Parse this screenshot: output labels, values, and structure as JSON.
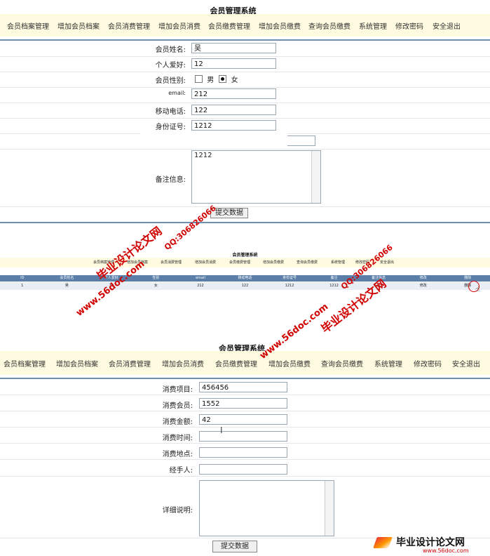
{
  "panel1": {
    "title": "会员管理系统",
    "nav": [
      "会员档案管理",
      "增加会员档案",
      "会员消费管理",
      "增加会员消费",
      "会员缴费管理",
      "增加会员缴费",
      "查询会员缴费",
      "系统管理",
      "修改密码",
      "安全退出"
    ],
    "fields": [
      {
        "label": "会员姓名:",
        "value": "吴"
      },
      {
        "label": "个人爱好:",
        "value": "12"
      },
      {
        "label": "email:",
        "value": "212"
      },
      {
        "label": "移动电话:",
        "value": "122"
      },
      {
        "label": "身份证号:",
        "value": "1212"
      }
    ],
    "gender": {
      "label": "会员性别:",
      "male": "男",
      "female": "女"
    },
    "remark": {
      "label": "备注信息:",
      "value": "1212"
    },
    "submit": "提交数据"
  },
  "panel2": {
    "title": "会员管理系统",
    "nav": [
      "会员档案管理",
      "增加会员档案",
      "会员消费管理",
      "增加会员消费",
      "会员缴费管理",
      "增加会员缴费",
      "查询会员缴费",
      "系统管理",
      "修改密码",
      "安全退出"
    ],
    "headers": [
      "ID",
      "会员姓名",
      "个人爱好",
      "性别",
      "email",
      "移动电话",
      "身份证号",
      "备注",
      "备注信息",
      "修改",
      "删除"
    ],
    "row": [
      "1",
      "吴",
      "12",
      "女",
      "212",
      "122",
      "1212",
      "1212",
      "1212",
      "修改",
      "删除"
    ]
  },
  "panel3": {
    "title": "会员管理系统",
    "nav": [
      "会员档案管理",
      "增加会员档案",
      "会员消费管理",
      "增加会员消费",
      "会员缴费管理",
      "增加会员缴费",
      "查询会员缴费",
      "系统管理",
      "修改密码",
      "安全退出"
    ],
    "fields": [
      {
        "label": "消费项目:",
        "value": "456456"
      },
      {
        "label": "消费会员:",
        "value": "1552"
      },
      {
        "label": "消费金额:",
        "value": "42"
      },
      {
        "label": "消费时间:",
        "value": ""
      },
      {
        "label": "消费地点:",
        "value": ""
      },
      {
        "label": "经手人:",
        "value": ""
      }
    ],
    "detail": {
      "label": "详细说明:",
      "value": ""
    },
    "submit": "提交数据"
  },
  "watermark": {
    "site": "毕业设计论文网",
    "url": "www.56doc.com",
    "qq": "QQ:306826066",
    "footer_site": "毕业设计论文网",
    "footer_url": "www.56doc.com"
  },
  "colors": {
    "nav_bg": "#fffbe0",
    "table_header": "#5a7ea8",
    "watermark": "#d10000",
    "line": "#6f8fb0"
  }
}
